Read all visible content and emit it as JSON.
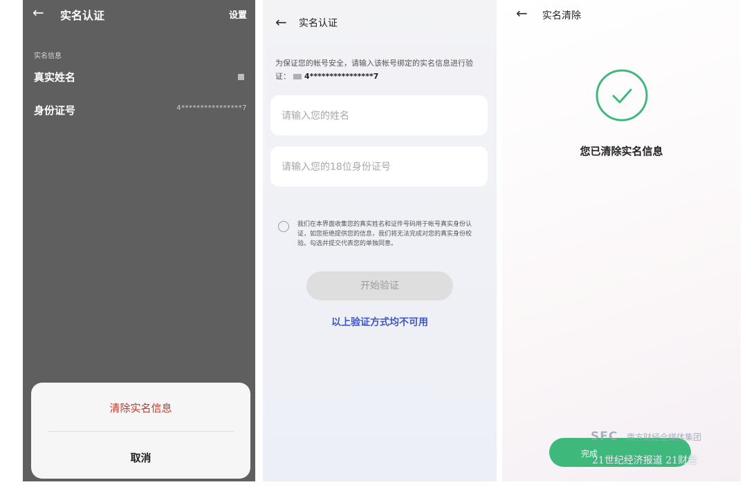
{
  "panel1": {
    "back_icon": "arrow-left-icon",
    "title": "实名认证",
    "settings": "设置",
    "section_title": "实名信息",
    "name_label": "真实姓名",
    "id_label": "身份证号",
    "id_value": "4****************7",
    "sheet": {
      "clear": "清除实名信息",
      "cancel": "取消"
    }
  },
  "panel2": {
    "back_icon": "arrow-left-icon",
    "title": "实名认证",
    "intro": "为保证您的帐号安全，请输入该帐号绑定的实名信息进行验证：",
    "intro_id": "4****************7",
    "name_placeholder": "请输入您的姓名",
    "id_placeholder": "请输入您的18位身份证号",
    "consent": "我们在本界面收集您的真实姓名和证件号码用于帐号真实身份认证，如您拒绝提供您的信息，我们将无法完成对您的真实身份校验。勾选并提交代表您的单独同意。",
    "start_button": "开始验证",
    "alt_link": "以上验证方式均不可用"
  },
  "panel3": {
    "back_icon": "arrow-left-icon",
    "title": "实名清除",
    "success_icon": "check-circle-icon",
    "message": "您已清除实名信息",
    "button_label": "完成",
    "watermark_logo": "SFC",
    "watermark_group": "南方财经全媒体集团",
    "watermark_brand": "21世纪经济报道 21财经"
  },
  "colors": {
    "accent_green": "#3fb87c",
    "link_blue": "#3d57c9",
    "danger_red": "#c0392b"
  }
}
